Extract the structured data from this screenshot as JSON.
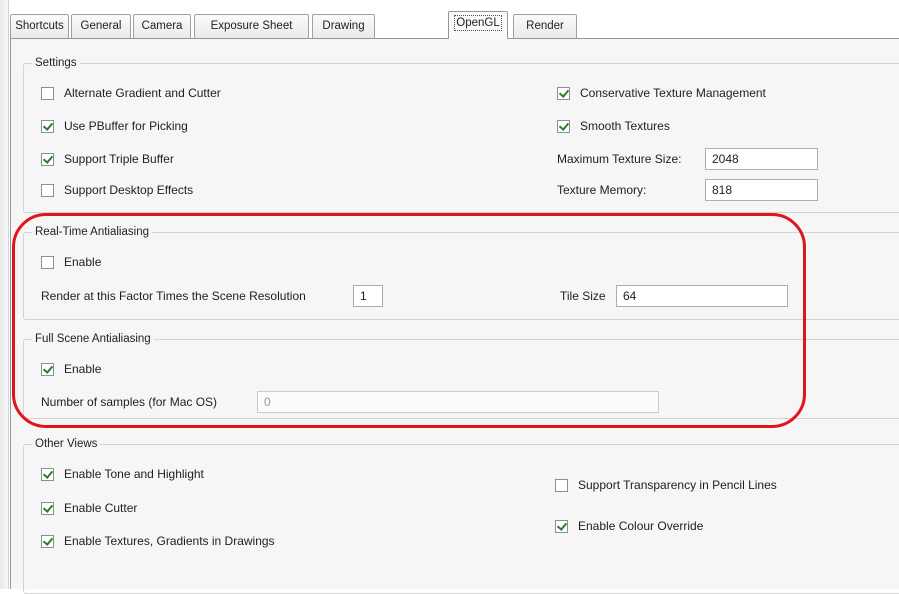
{
  "tabs": [
    {
      "label": "Shortcuts"
    },
    {
      "label": "General"
    },
    {
      "label": "Camera"
    },
    {
      "label": "Exposure Sheet"
    },
    {
      "label": "Drawing"
    },
    {
      "label": "OpenGL"
    },
    {
      "label": "Render"
    }
  ],
  "active_tab": "OpenGL",
  "settings": {
    "title": "Settings",
    "alternate_gradient": {
      "label": "Alternate Gradient and Cutter",
      "checked": false
    },
    "use_pbuffer": {
      "label": "Use PBuffer for Picking",
      "checked": true
    },
    "triple_buffer": {
      "label": "Support Triple Buffer",
      "checked": true
    },
    "desktop_effects": {
      "label": "Support Desktop Effects",
      "checked": false
    },
    "conservative_texture": {
      "label": "Conservative Texture Management",
      "checked": true
    },
    "smooth_textures": {
      "label": "Smooth Textures",
      "checked": true
    },
    "max_texture_size": {
      "label": "Maximum Texture Size:",
      "value": "2048"
    },
    "texture_memory": {
      "label": "Texture Memory:",
      "value": "818"
    }
  },
  "realtime_aa": {
    "title": "Real-Time Antialiasing",
    "enable": {
      "label": "Enable",
      "checked": false
    },
    "factor": {
      "label": "Render at this Factor Times the Scene Resolution",
      "value": "1"
    },
    "tile_size": {
      "label": "Tile Size",
      "value": "64"
    }
  },
  "fullscene_aa": {
    "title": "Full Scene Antialiasing",
    "enable": {
      "label": "Enable",
      "checked": true
    },
    "samples": {
      "label": "Number of samples (for Mac OS)",
      "value": "0"
    }
  },
  "other_views": {
    "title": "Other Views",
    "tone_highlight": {
      "label": "Enable Tone and Highlight",
      "checked": true
    },
    "cutter": {
      "label": "Enable Cutter",
      "checked": true
    },
    "textures_gradients": {
      "label": "Enable Textures, Gradients in Drawings",
      "checked": true
    },
    "transparency_pencil": {
      "label": "Support Transparency in Pencil Lines",
      "checked": false
    },
    "colour_override": {
      "label": "Enable Colour Override",
      "checked": true
    }
  },
  "colors": {
    "highlight": "#e0141b",
    "check": "#2a7d2a"
  }
}
